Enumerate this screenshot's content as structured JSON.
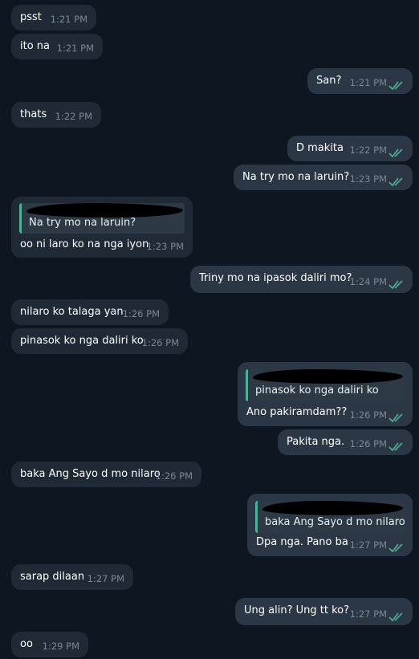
{
  "messages": [
    {
      "text": "psst",
      "time": "1:21 PM",
      "direction": "in",
      "read": false
    },
    {
      "text": "ito na",
      "time": "1:21 PM",
      "direction": "in",
      "read": false
    },
    {
      "text": "San?",
      "time": "1:21 PM",
      "direction": "out",
      "read": true
    },
    {
      "text": "thats",
      "time": "1:22 PM",
      "direction": "in",
      "read": false
    },
    {
      "text": "D makita",
      "time": "1:22 PM",
      "direction": "out",
      "read": true
    },
    {
      "text": "Na try mo na laruin?",
      "time": "1:23 PM",
      "direction": "out",
      "read": true
    },
    {
      "text": "oo ni laro ko na nga iyon",
      "time": "1:23 PM",
      "direction": "in",
      "quote": "Na try mo na laruin?"
    },
    {
      "text": "Triny mo na ipasok daliri mo?",
      "time": "1:24 PM",
      "direction": "out",
      "read": true
    },
    {
      "text": "nilaro ko talaga yan",
      "time": "1:26 PM",
      "direction": "in"
    },
    {
      "text": "pinasok ko nga daliri ko",
      "time": "1:26 PM",
      "direction": "in"
    },
    {
      "text": "Ano pakiramdam??",
      "time": "1:26 PM",
      "direction": "out",
      "read": true,
      "quote": "pinasok ko nga daliri ko"
    },
    {
      "text": "Pakita nga.",
      "time": "1:26 PM",
      "direction": "out",
      "read": true
    },
    {
      "text": "baka Ang Sayo d mo nilaro",
      "time": "1:26 PM",
      "direction": "in"
    },
    {
      "text": "Dpa nga. Pano ba",
      "time": "1:27 PM",
      "direction": "out",
      "read": true,
      "quote": "baka Ang Sayo d mo nilaro"
    },
    {
      "text": "sarap dilaan",
      "time": "1:27 PM",
      "direction": "in"
    },
    {
      "text": "Ung alin? Ung tt ko?",
      "time": "1:27 PM",
      "direction": "out",
      "read": true
    },
    {
      "text": "oo",
      "time": "1:29 PM",
      "direction": "in"
    }
  ],
  "colors": {
    "background": "#0e1621",
    "incoming_bubble": "#1f2a36",
    "outgoing_bubble": "#2b3744",
    "read_check": "#4bb197",
    "quote_bar": "#4bb197"
  }
}
